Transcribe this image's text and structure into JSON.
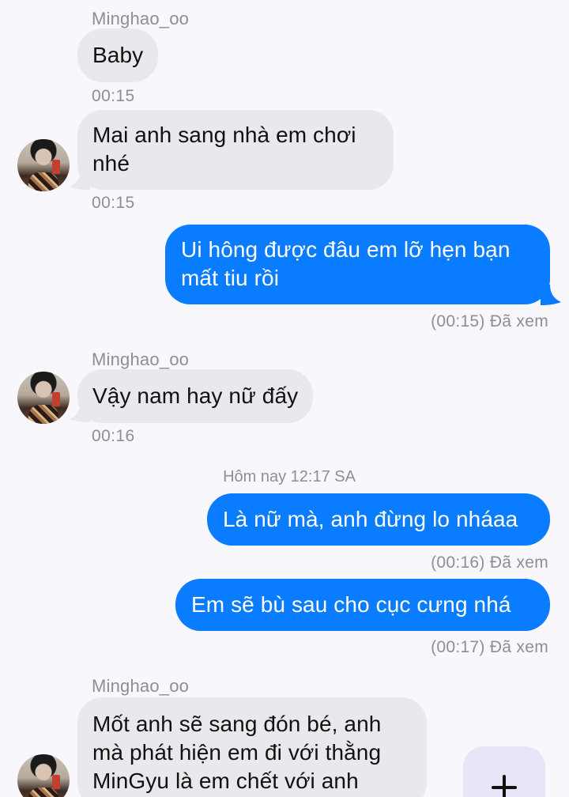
{
  "conversation": {
    "items": [
      {
        "type": "name",
        "text": "Minghao_oo"
      },
      {
        "type": "in",
        "text": "Baby"
      },
      {
        "type": "time",
        "text": "00:15"
      },
      {
        "type": "in",
        "text_lines": [
          "Mai anh sang nhà em chơi",
          "nhé"
        ]
      },
      {
        "type": "time",
        "text": "00:15"
      },
      {
        "type": "out",
        "text_lines": [
          "Ui hông được đâu em lỡ hẹn bạn",
          "mất tiu rồi"
        ]
      },
      {
        "type": "receipt",
        "text": "(00:15) Đã xem"
      },
      {
        "type": "name",
        "text": "Minghao_oo"
      },
      {
        "type": "in",
        "text": "Vậy nam hay nữ đấy"
      },
      {
        "type": "time",
        "text": "00:16"
      },
      {
        "type": "divider",
        "text": "Hôm nay 12:17 SA"
      },
      {
        "type": "out",
        "text": "Là nữ mà, anh đừng lo nháaa"
      },
      {
        "type": "receipt",
        "text": "(00:16) Đã xem"
      },
      {
        "type": "out",
        "text": "Em sẽ bù sau cho cục cưng nhá"
      },
      {
        "type": "receipt",
        "text": "(00:17) Đã xem"
      },
      {
        "type": "name",
        "text": "Minghao_oo"
      },
      {
        "type": "in",
        "text_lines": [
          "Mốt anh sẽ sang đón bé, anh",
          "mà phát hiện em đi với thằng",
          "MinGyu là em chết với anh"
        ]
      }
    ]
  },
  "names": {
    "contact_1": "Minghao_oo",
    "contact_2": "Minghao_oo",
    "contact_3": "Minghao_oo"
  },
  "messages": {
    "m1": "Baby",
    "m2_line1": "Mai anh sang nhà em chơi",
    "m2_line2": "nhé",
    "m3_line1": "Ui hông được đâu em lỡ hẹn bạn",
    "m3_line2": "mất tiu rồi",
    "m4": "Vậy nam hay nữ đấy",
    "m5": "Là nữ mà, anh đừng lo nháaa",
    "m6": "Em sẽ bù sau cho cục cưng nhá",
    "m7_line1": "Mốt anh sẽ sang đón bé, anh",
    "m7_line2": "mà phát hiện em đi với thằng",
    "m7_line3": "MinGyu là em chết với anh"
  },
  "times": {
    "t1": "00:15",
    "t2": "00:15",
    "t3": "00:16"
  },
  "receipts": {
    "r1": "(00:15) Đã xem",
    "r2": "(00:16) Đã xem",
    "r3": "(00:17) Đã xem"
  },
  "divider": "Hôm nay 12:17 SA",
  "add_button": {
    "icon": "plus-icon"
  },
  "colors": {
    "incoming_bubble": "#e9e9ed",
    "outgoing_bubble": "#0a7cff",
    "meta_text": "#8e8e93",
    "background": "#f8f7fc",
    "add_button_bg": "#e9e4f7"
  }
}
